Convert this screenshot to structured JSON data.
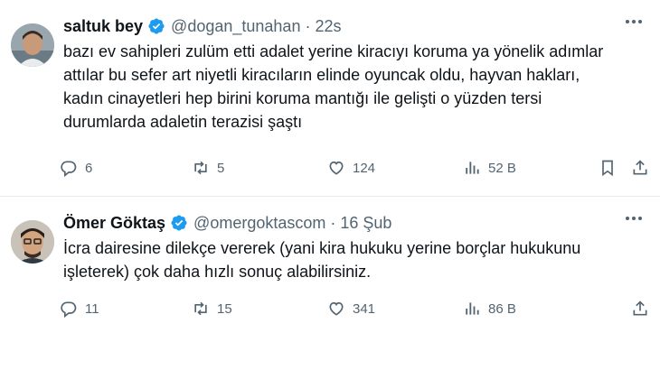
{
  "tweets": [
    {
      "name": "saltuk bey",
      "handle": "@dogan_tunahan",
      "separator": "·",
      "time": "22s",
      "text": "bazı ev sahipleri zulüm etti adalet  yerine kiracıyı koruma ya yönelik adımlar\nattılar bu sefer art niyetli kiracıların elinde oyuncak oldu, hayvan hakları,\nkadın cinayetleri hep birini koruma mantığı ile gelişti o yüzden tersi\ndurumlarda  adaletin terazisi şaştı",
      "replies": "6",
      "retweets": "5",
      "likes": "124",
      "views": "52 B",
      "avatar_icon": "user-photo-avatar"
    },
    {
      "name": "Ömer Göktaş",
      "handle": "@omergoktascom",
      "separator": "·",
      "time": "16 Şub",
      "text": "İcra dairesine dilekçe vererek (yani kira hukuku yerine borçlar hukukunu\nişleterek) çok daha hızlı sonuç alabilirsiniz.",
      "replies": "11",
      "retweets": "15",
      "likes": "341",
      "views": "86 B",
      "avatar_icon": "user-photo-avatar"
    }
  ],
  "colors": {
    "verified": "#1d9bf0",
    "secondary_text": "#536471",
    "primary_text": "#0f1419",
    "divider": "#e6ecf0"
  },
  "icons": [
    "verified-badge-icon",
    "more-icon",
    "reply-icon",
    "retweet-icon",
    "like-icon",
    "views-icon",
    "bookmark-icon",
    "share-icon"
  ]
}
